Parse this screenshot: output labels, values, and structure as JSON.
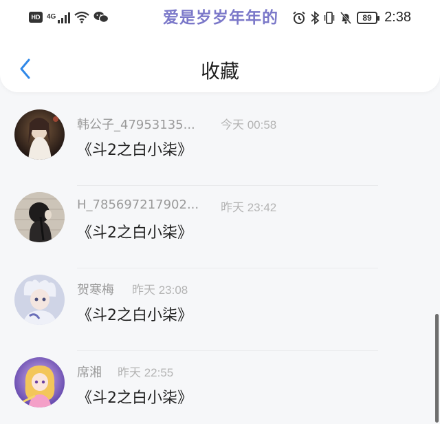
{
  "status_bar": {
    "hd_label": "HD",
    "network_label": "4G",
    "banner_text": "爱是岁岁年年的",
    "battery_level": "89",
    "time": "2:38"
  },
  "header": {
    "back_icon": "chevron-left-icon",
    "title": "收藏"
  },
  "accent_color": "#2f88e8",
  "favorites": [
    {
      "name": "韩公子_47953135...",
      "time": "今天 00:58",
      "title": "《斗2之白小柒》"
    },
    {
      "name": "H_785697217902...",
      "time": "昨天 23:42",
      "title": "《斗2之白小柒》"
    },
    {
      "name": "贺寒梅",
      "time": "昨天 23:08",
      "title": "《斗2之白小柒》"
    },
    {
      "name": "席湘",
      "time": "昨天 22:55",
      "title": "《斗2之白小柒》"
    }
  ]
}
